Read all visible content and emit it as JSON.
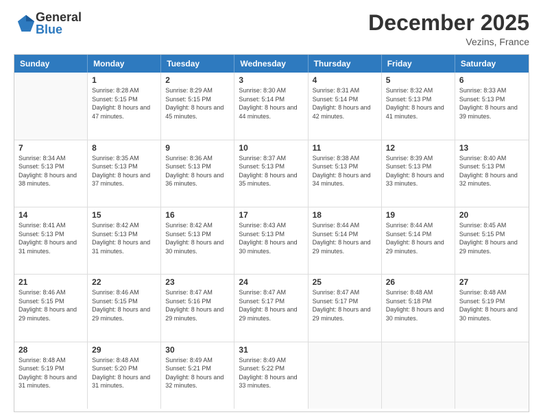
{
  "header": {
    "logo": {
      "general": "General",
      "blue": "Blue"
    },
    "title": "December 2025",
    "location": "Vezins, France"
  },
  "calendar": {
    "days_of_week": [
      "Sunday",
      "Monday",
      "Tuesday",
      "Wednesday",
      "Thursday",
      "Friday",
      "Saturday"
    ],
    "weeks": [
      [
        {
          "day": "",
          "sunrise": "",
          "sunset": "",
          "daylight": "",
          "empty": true
        },
        {
          "day": "1",
          "sunrise": "Sunrise: 8:28 AM",
          "sunset": "Sunset: 5:15 PM",
          "daylight": "Daylight: 8 hours and 47 minutes."
        },
        {
          "day": "2",
          "sunrise": "Sunrise: 8:29 AM",
          "sunset": "Sunset: 5:15 PM",
          "daylight": "Daylight: 8 hours and 45 minutes."
        },
        {
          "day": "3",
          "sunrise": "Sunrise: 8:30 AM",
          "sunset": "Sunset: 5:14 PM",
          "daylight": "Daylight: 8 hours and 44 minutes."
        },
        {
          "day": "4",
          "sunrise": "Sunrise: 8:31 AM",
          "sunset": "Sunset: 5:14 PM",
          "daylight": "Daylight: 8 hours and 42 minutes."
        },
        {
          "day": "5",
          "sunrise": "Sunrise: 8:32 AM",
          "sunset": "Sunset: 5:13 PM",
          "daylight": "Daylight: 8 hours and 41 minutes."
        },
        {
          "day": "6",
          "sunrise": "Sunrise: 8:33 AM",
          "sunset": "Sunset: 5:13 PM",
          "daylight": "Daylight: 8 hours and 39 minutes."
        }
      ],
      [
        {
          "day": "7",
          "sunrise": "Sunrise: 8:34 AM",
          "sunset": "Sunset: 5:13 PM",
          "daylight": "Daylight: 8 hours and 38 minutes."
        },
        {
          "day": "8",
          "sunrise": "Sunrise: 8:35 AM",
          "sunset": "Sunset: 5:13 PM",
          "daylight": "Daylight: 8 hours and 37 minutes."
        },
        {
          "day": "9",
          "sunrise": "Sunrise: 8:36 AM",
          "sunset": "Sunset: 5:13 PM",
          "daylight": "Daylight: 8 hours and 36 minutes."
        },
        {
          "day": "10",
          "sunrise": "Sunrise: 8:37 AM",
          "sunset": "Sunset: 5:13 PM",
          "daylight": "Daylight: 8 hours and 35 minutes."
        },
        {
          "day": "11",
          "sunrise": "Sunrise: 8:38 AM",
          "sunset": "Sunset: 5:13 PM",
          "daylight": "Daylight: 8 hours and 34 minutes."
        },
        {
          "day": "12",
          "sunrise": "Sunrise: 8:39 AM",
          "sunset": "Sunset: 5:13 PM",
          "daylight": "Daylight: 8 hours and 33 minutes."
        },
        {
          "day": "13",
          "sunrise": "Sunrise: 8:40 AM",
          "sunset": "Sunset: 5:13 PM",
          "daylight": "Daylight: 8 hours and 32 minutes."
        }
      ],
      [
        {
          "day": "14",
          "sunrise": "Sunrise: 8:41 AM",
          "sunset": "Sunset: 5:13 PM",
          "daylight": "Daylight: 8 hours and 31 minutes."
        },
        {
          "day": "15",
          "sunrise": "Sunrise: 8:42 AM",
          "sunset": "Sunset: 5:13 PM",
          "daylight": "Daylight: 8 hours and 31 minutes."
        },
        {
          "day": "16",
          "sunrise": "Sunrise: 8:42 AM",
          "sunset": "Sunset: 5:13 PM",
          "daylight": "Daylight: 8 hours and 30 minutes."
        },
        {
          "day": "17",
          "sunrise": "Sunrise: 8:43 AM",
          "sunset": "Sunset: 5:13 PM",
          "daylight": "Daylight: 8 hours and 30 minutes."
        },
        {
          "day": "18",
          "sunrise": "Sunrise: 8:44 AM",
          "sunset": "Sunset: 5:14 PM",
          "daylight": "Daylight: 8 hours and 29 minutes."
        },
        {
          "day": "19",
          "sunrise": "Sunrise: 8:44 AM",
          "sunset": "Sunset: 5:14 PM",
          "daylight": "Daylight: 8 hours and 29 minutes."
        },
        {
          "day": "20",
          "sunrise": "Sunrise: 8:45 AM",
          "sunset": "Sunset: 5:15 PM",
          "daylight": "Daylight: 8 hours and 29 minutes."
        }
      ],
      [
        {
          "day": "21",
          "sunrise": "Sunrise: 8:46 AM",
          "sunset": "Sunset: 5:15 PM",
          "daylight": "Daylight: 8 hours and 29 minutes."
        },
        {
          "day": "22",
          "sunrise": "Sunrise: 8:46 AM",
          "sunset": "Sunset: 5:15 PM",
          "daylight": "Daylight: 8 hours and 29 minutes."
        },
        {
          "day": "23",
          "sunrise": "Sunrise: 8:47 AM",
          "sunset": "Sunset: 5:16 PM",
          "daylight": "Daylight: 8 hours and 29 minutes."
        },
        {
          "day": "24",
          "sunrise": "Sunrise: 8:47 AM",
          "sunset": "Sunset: 5:17 PM",
          "daylight": "Daylight: 8 hours and 29 minutes."
        },
        {
          "day": "25",
          "sunrise": "Sunrise: 8:47 AM",
          "sunset": "Sunset: 5:17 PM",
          "daylight": "Daylight: 8 hours and 29 minutes."
        },
        {
          "day": "26",
          "sunrise": "Sunrise: 8:48 AM",
          "sunset": "Sunset: 5:18 PM",
          "daylight": "Daylight: 8 hours and 30 minutes."
        },
        {
          "day": "27",
          "sunrise": "Sunrise: 8:48 AM",
          "sunset": "Sunset: 5:19 PM",
          "daylight": "Daylight: 8 hours and 30 minutes."
        }
      ],
      [
        {
          "day": "28",
          "sunrise": "Sunrise: 8:48 AM",
          "sunset": "Sunset: 5:19 PM",
          "daylight": "Daylight: 8 hours and 31 minutes."
        },
        {
          "day": "29",
          "sunrise": "Sunrise: 8:48 AM",
          "sunset": "Sunset: 5:20 PM",
          "daylight": "Daylight: 8 hours and 31 minutes."
        },
        {
          "day": "30",
          "sunrise": "Sunrise: 8:49 AM",
          "sunset": "Sunset: 5:21 PM",
          "daylight": "Daylight: 8 hours and 32 minutes."
        },
        {
          "day": "31",
          "sunrise": "Sunrise: 8:49 AM",
          "sunset": "Sunset: 5:22 PM",
          "daylight": "Daylight: 8 hours and 33 minutes."
        },
        {
          "day": "",
          "sunrise": "",
          "sunset": "",
          "daylight": "",
          "empty": true
        },
        {
          "day": "",
          "sunrise": "",
          "sunset": "",
          "daylight": "",
          "empty": true
        },
        {
          "day": "",
          "sunrise": "",
          "sunset": "",
          "daylight": "",
          "empty": true
        }
      ]
    ]
  }
}
